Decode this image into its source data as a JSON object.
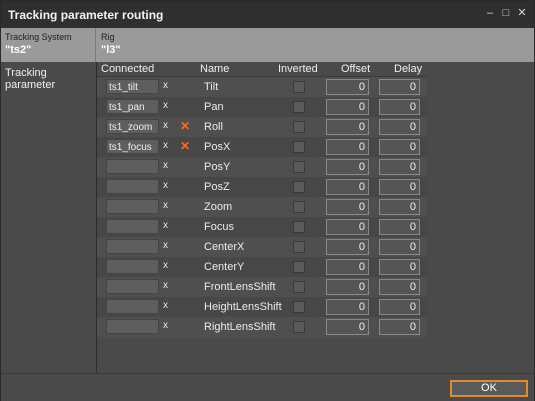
{
  "window": {
    "title": "Tracking parameter routing"
  },
  "header": {
    "tracking_system_label": "Tracking System",
    "tracking_system_value": "\"ts2\"",
    "rig_label": "Rig",
    "rig_value": "\"l3\""
  },
  "left_pane": {
    "label": "Tracking parameter"
  },
  "columns": {
    "connected": "Connected",
    "name": "Name",
    "inverted": "Inverted",
    "offset": "Offset",
    "delay": "Delay"
  },
  "rows": [
    {
      "connected": "ts1_tilt",
      "name": "Tilt",
      "conflict": false,
      "inverted": false,
      "offset": "0",
      "delay": "0"
    },
    {
      "connected": "ts1_pan",
      "name": "Pan",
      "conflict": false,
      "inverted": false,
      "offset": "0",
      "delay": "0"
    },
    {
      "connected": "ts1_zoom",
      "name": "Roll",
      "conflict": true,
      "inverted": false,
      "offset": "0",
      "delay": "0"
    },
    {
      "connected": "ts1_focus",
      "name": "PosX",
      "conflict": true,
      "inverted": false,
      "offset": "0",
      "delay": "0"
    },
    {
      "connected": "",
      "name": "PosY",
      "conflict": false,
      "inverted": false,
      "offset": "0",
      "delay": "0"
    },
    {
      "connected": "",
      "name": "PosZ",
      "conflict": false,
      "inverted": false,
      "offset": "0",
      "delay": "0"
    },
    {
      "connected": "",
      "name": "Zoom",
      "conflict": false,
      "inverted": false,
      "offset": "0",
      "delay": "0"
    },
    {
      "connected": "",
      "name": "Focus",
      "conflict": false,
      "inverted": false,
      "offset": "0",
      "delay": "0"
    },
    {
      "connected": "",
      "name": "CenterX",
      "conflict": false,
      "inverted": false,
      "offset": "0",
      "delay": "0"
    },
    {
      "connected": "",
      "name": "CenterY",
      "conflict": false,
      "inverted": false,
      "offset": "0",
      "delay": "0"
    },
    {
      "connected": "",
      "name": "FrontLensShift",
      "conflict": false,
      "inverted": false,
      "offset": "0",
      "delay": "0"
    },
    {
      "connected": "",
      "name": "HeightLensShift",
      "conflict": false,
      "inverted": false,
      "offset": "0",
      "delay": "0"
    },
    {
      "connected": "",
      "name": "RightLensShift",
      "conflict": false,
      "inverted": false,
      "offset": "0",
      "delay": "0"
    }
  ],
  "row_clear_label": "x",
  "conflict_icon": "cross-icon",
  "footer": {
    "ok_label": "OK"
  },
  "colors": {
    "accent": "#e38b2a",
    "conflict": "#ff6a1c"
  }
}
